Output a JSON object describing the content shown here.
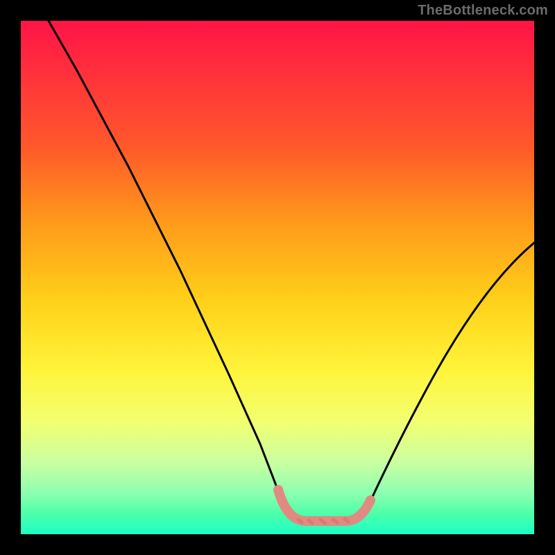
{
  "watermark": "TheBottleneck.com",
  "chart_data": {
    "type": "line",
    "title": "",
    "xlabel": "",
    "ylabel": "",
    "xlim": [
      0,
      100
    ],
    "ylim": [
      0,
      100
    ],
    "grid": false,
    "legend": false,
    "background_gradient": {
      "direction": "vertical",
      "stops": [
        {
          "pos": 0.0,
          "color": "#ff1447"
        },
        {
          "pos": 0.25,
          "color": "#ff5a2a"
        },
        {
          "pos": 0.55,
          "color": "#ffd21a"
        },
        {
          "pos": 0.78,
          "color": "#f3ff70"
        },
        {
          "pos": 0.92,
          "color": "#8cffb0"
        },
        {
          "pos": 1.0,
          "color": "#1affc8"
        }
      ]
    },
    "series": [
      {
        "name": "bottleneck_curve",
        "color": "#000000",
        "x": [
          5,
          11,
          21,
          31,
          41,
          47,
          50,
          55,
          63,
          68,
          73,
          78,
          85,
          92,
          100
        ],
        "y": [
          100,
          91,
          72,
          51,
          31,
          18,
          9,
          3,
          3,
          7,
          15,
          27,
          38,
          47,
          57
        ]
      },
      {
        "name": "optimal_zone",
        "color": "#e08a82",
        "x": [
          50,
          55,
          60,
          65,
          68
        ],
        "y": [
          9,
          3,
          3,
          3,
          7
        ]
      }
    ],
    "annotations": []
  }
}
